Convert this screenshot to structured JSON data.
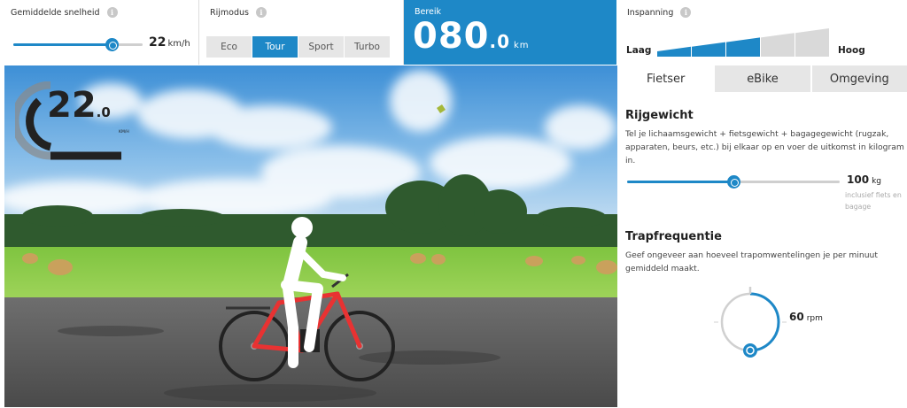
{
  "top": {
    "speed": {
      "title": "Gemiddelde snelheid",
      "value": "22",
      "unit": "km/h",
      "slider_fraction": 0.76
    },
    "mode": {
      "title": "Rijmodus",
      "options": [
        "Eco",
        "Tour",
        "Sport",
        "Turbo"
      ],
      "selected": "Tour"
    },
    "range": {
      "title": "Bereik",
      "value_int": "080",
      "value_dec": ".0",
      "unit": "km"
    },
    "effort": {
      "title": "Inspanning",
      "low_label": "Laag",
      "high_label": "Hoog",
      "level": 3,
      "steps": 5
    }
  },
  "scene": {
    "speedo": {
      "value_int": "22",
      "value_dec": ".0",
      "unit": "KM/H"
    }
  },
  "panel": {
    "tabs": [
      "Fietser",
      "eBike",
      "Omgeving"
    ],
    "active_tab": "Fietser",
    "weight": {
      "title": "Rijgewicht",
      "text": "Tel je lichaamsgewicht + fietsgewicht + bagagegewicht (rugzak, apparaten, beurs, etc.) bij elkaar op en voer de uitkomst in kilogram in.",
      "value": "100",
      "unit": "kg",
      "note": "inclusief fiets en bagage",
      "slider_fraction": 0.5
    },
    "cadence": {
      "title": "Trapfrequentie",
      "text": "Geef ongeveer aan hoeveel trapomwentelingen je per minuut gemiddeld maakt.",
      "value": "60",
      "unit": "rpm",
      "dial_fraction": 0.5
    }
  },
  "colors": {
    "accent": "#1e88c7",
    "track": "#cfcfcf",
    "button": "#e6e6e6"
  },
  "icons": [
    "info-icon",
    "speedometer-arc",
    "cyclist-illustration"
  ]
}
